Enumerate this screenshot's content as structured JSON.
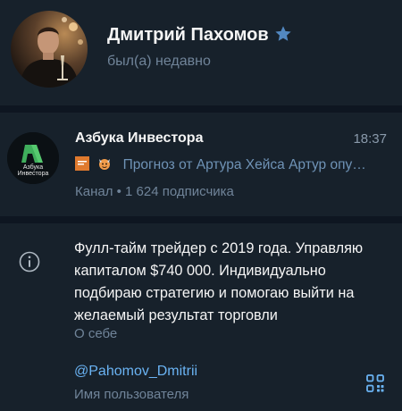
{
  "profile": {
    "name": "Дмитрий Пахомов",
    "status": "был(а) недавно",
    "badge_color": "#5288c1"
  },
  "channel": {
    "name": "Азбука Инвестора",
    "time": "18:37",
    "preview": "Прогноз от Артура Хейса  Артур опу…",
    "subscribers": "Канал • 1 624 подписчика",
    "logo_text_line1": "Азбука",
    "logo_text_line2": "Инвестора"
  },
  "info": {
    "bio": "Фулл-тайм трейдер с 2019 года. Управляю капиталом $740 000. Индивидуально подбираю стратегию и помогаю выйти на желаемый результат торговли",
    "bio_label": "О себе",
    "username": "@Pahomov_Dmitrii",
    "username_label": "Имя пользователя"
  },
  "icons": {
    "badge": "star-icon",
    "info": "info-circle-icon",
    "qr": "qr-code-icon"
  },
  "colors": {
    "background": "#17212b",
    "separator": "#0e1621",
    "link": "#6ab3f3",
    "secondary_text": "#708499",
    "preview_text": "#6f93b6"
  }
}
